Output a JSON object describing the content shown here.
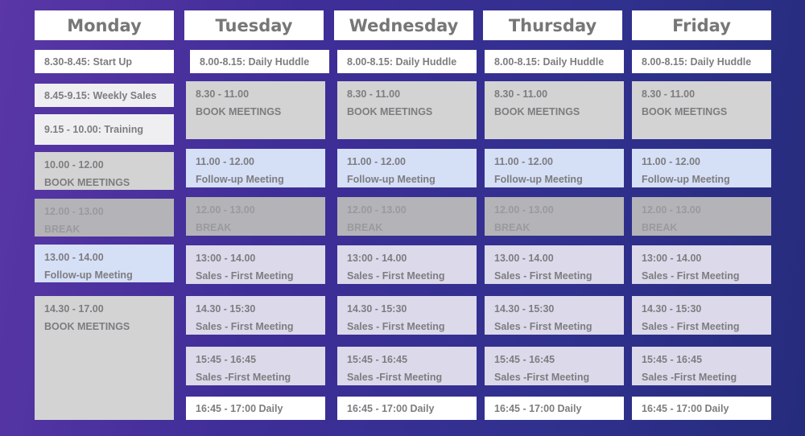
{
  "days": [
    {
      "name": "Monday",
      "events": [
        {
          "text": "8.30-8.45: Start Up",
          "type": "white"
        },
        {
          "text": "8.45-9.15: Weekly Sales",
          "type": "light"
        },
        {
          "text": "9.15 - 10.00: Training",
          "type": "light"
        },
        {
          "time": "10.00 - 12.00",
          "title": "BOOK MEETINGS",
          "type": "gray"
        },
        {
          "time": "12.00 - 13.00",
          "title": "BREAK",
          "type": "break"
        },
        {
          "time": "13.00 - 14.00",
          "title": "Follow-up Meeting",
          "type": "follow"
        },
        {
          "time": "14.30 - 17.00",
          "title": "BOOK MEETINGS",
          "type": "gray"
        }
      ]
    },
    {
      "name": "Tuesday",
      "events": [
        {
          "text": "8.00-8.15: Daily Huddle",
          "type": "white"
        },
        {
          "time": "8.30 - 11.00",
          "title": "BOOK MEETINGS",
          "type": "gray"
        },
        {
          "time": "11.00 - 12.00",
          "title": "Follow-up Meeting",
          "type": "follow"
        },
        {
          "time": "12.00 - 13.00",
          "title": "BREAK",
          "type": "break"
        },
        {
          "time": "13:00 - 14.00",
          "title": "Sales - First Meeting",
          "type": "sales"
        },
        {
          "time": "14.30 - 15:30",
          "title": "Sales - First Meeting",
          "type": "sales"
        },
        {
          "time": "15:45 - 16:45",
          "title": "Sales -First Meeting",
          "type": "sales"
        },
        {
          "text": "16:45 - 17:00 Daily",
          "type": "white"
        }
      ]
    },
    {
      "name": "Wednesday",
      "events": [
        {
          "text": "8.00-8.15: Daily Huddle",
          "type": "white"
        },
        {
          "time": "8.30 - 11.00",
          "title": "BOOK MEETINGS",
          "type": "gray"
        },
        {
          "time": "11.00 - 12.00",
          "title": "Follow-up Meeting",
          "type": "follow"
        },
        {
          "time": "12.00 - 13.00",
          "title": "BREAK",
          "type": "break"
        },
        {
          "time": "13:00 - 14.00",
          "title": "Sales - First Meeting",
          "type": "sales"
        },
        {
          "time": "14.30 - 15:30",
          "title": "Sales - First Meeting",
          "type": "sales"
        },
        {
          "time": "15:45 - 16:45",
          "title": "Sales -First Meeting",
          "type": "sales"
        },
        {
          "text": "16:45 - 17:00 Daily",
          "type": "white"
        }
      ]
    },
    {
      "name": "Thursday",
      "events": [
        {
          "text": "8.00-8.15: Daily Huddle",
          "type": "white"
        },
        {
          "time": "8.30 - 11.00",
          "title": "BOOK MEETINGS",
          "type": "gray"
        },
        {
          "time": "11.00 - 12.00",
          "title": "Follow-up Meeting",
          "type": "follow"
        },
        {
          "time": "12.00 - 13.00",
          "title": "BREAK",
          "type": "break"
        },
        {
          "time": "13.00 - 14.00",
          "title": "Sales - First Meeting",
          "type": "sales"
        },
        {
          "time": "14.30 - 15:30",
          "title": "Sales - First Meeting",
          "type": "sales"
        },
        {
          "time": "15:45 - 16:45",
          "title": "Sales -First Meeting",
          "type": "sales"
        },
        {
          "text": "16:45 - 17:00 Daily",
          "type": "white"
        }
      ]
    },
    {
      "name": "Friday",
      "events": [
        {
          "text": "8.00-8.15: Daily Huddle",
          "type": "white"
        },
        {
          "time": "8.30 - 11.00",
          "title": "BOOK MEETINGS",
          "type": "gray"
        },
        {
          "time": "11.00 - 12.00",
          "title": "Follow-up Meeting",
          "type": "follow"
        },
        {
          "time": "12.00 - 13.00",
          "title": "BREAK",
          "type": "break"
        },
        {
          "time": "13:00 - 14.00",
          "title": "Sales - First Meeting",
          "type": "sales"
        },
        {
          "time": "14.30 - 15:30",
          "title": "Sales - First Meeting",
          "type": "sales"
        },
        {
          "time": "15:45 - 16:45",
          "title": "Sales -First Meeting",
          "type": "sales"
        },
        {
          "text": "16:45 - 17:00 Daily",
          "type": "white"
        }
      ]
    }
  ]
}
